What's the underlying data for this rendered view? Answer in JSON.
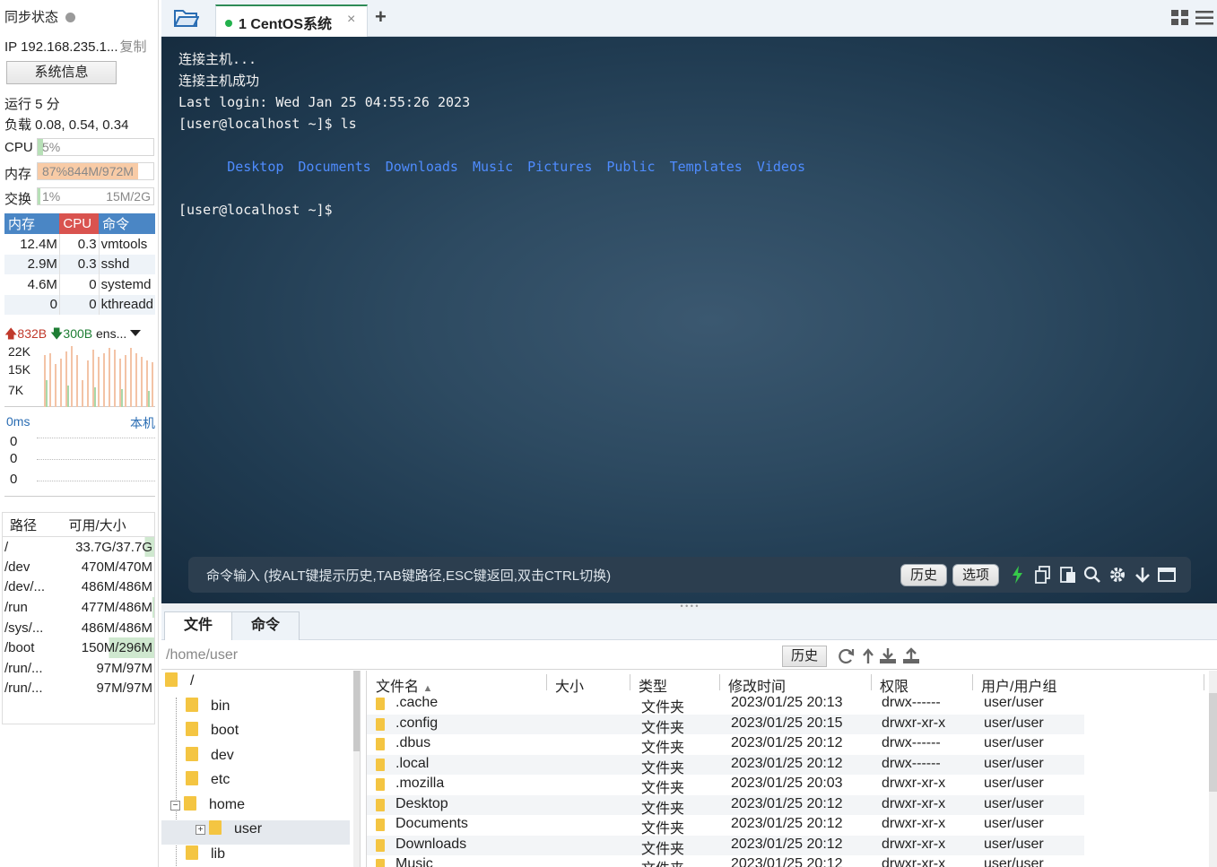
{
  "sidebar": {
    "sync_label": "同步状态",
    "ip_text": "IP 192.168.235.1...",
    "copy_label": "复制",
    "sysinfo_button": "系统信息",
    "uptime": "运行 5 分",
    "load": "负载 0.08, 0.54, 0.34",
    "cpu": {
      "label": "CPU",
      "text": "5%",
      "fraction": 0.05,
      "fill_color": "#b7e0b7"
    },
    "mem": {
      "label": "内存",
      "text": "87%844M/972M",
      "fraction": 0.87,
      "fill_color": "#f8cba6"
    },
    "swap": {
      "label": "交换",
      "text": "1%",
      "text_right": "15M/2G",
      "fraction": 0.01,
      "fill_color": "#b7e0b7"
    },
    "proc_headers": [
      {
        "label": "内存",
        "color": "#4a86c5"
      },
      {
        "label": "CPU",
        "color": "#d9534f"
      },
      {
        "label": "命令",
        "color": "#4a86c5"
      }
    ],
    "processes": [
      {
        "mem": "12.4M",
        "cpu": "0.3",
        "cmd": "vmtools"
      },
      {
        "mem": "2.9M",
        "cpu": "0.3",
        "cmd": "sshd"
      },
      {
        "mem": "4.6M",
        "cpu": "0",
        "cmd": "systemd"
      },
      {
        "mem": "0",
        "cpu": "0",
        "cmd": "kthreadd"
      }
    ],
    "net": {
      "up": "832B",
      "down": "300B",
      "iface": "ens...",
      "ticks": [
        "22K",
        "15K",
        "7K"
      ]
    },
    "ping": {
      "label": "0ms",
      "host": "本机",
      "values": [
        "0",
        "0",
        "0"
      ]
    },
    "disk_headers": [
      "路径",
      "可用/大小"
    ],
    "disks": [
      {
        "path": "/",
        "size": "33.7G/37.7G",
        "used_fraction": 0.1
      },
      {
        "path": "/dev",
        "size": "470M/470M",
        "used_fraction": 0
      },
      {
        "path": "/dev/...",
        "size": "486M/486M",
        "used_fraction": 0
      },
      {
        "path": "/run",
        "size": "477M/486M",
        "used_fraction": 0.02
      },
      {
        "path": "/sys/...",
        "size": "486M/486M",
        "used_fraction": 0
      },
      {
        "path": "/boot",
        "size": "150M/296M",
        "used_fraction": 0.49
      },
      {
        "path": "/run/...",
        "size": "97M/97M",
        "used_fraction": 0
      },
      {
        "path": "/run/...",
        "size": "97M/97M",
        "used_fraction": 0
      }
    ]
  },
  "tabbar": {
    "tab_label": "1 CentOS系统",
    "close_glyph": "×",
    "add_glyph": "+"
  },
  "terminal": {
    "lines": [
      "连接主机...",
      "连接主机成功",
      "Last login: Wed Jan 25 04:55:26 2023",
      "[user@localhost ~]$ ls"
    ],
    "ls_output": [
      "Desktop",
      "Documents",
      "Downloads",
      "Music",
      "Pictures",
      "Public",
      "Templates",
      "Videos"
    ],
    "prompt": "[user@localhost ~]$",
    "cmd_placeholder": "命令输入 (按ALT键提示历史,TAB键路径,ESC键返回,双击CTRL切换)",
    "history_btn": "历史",
    "options_btn": "选项"
  },
  "files": {
    "tab_files": "文件",
    "tab_commands": "命令",
    "path": "/home/user",
    "history_btn": "历史",
    "tree": [
      {
        "name": "/",
        "level": 0,
        "expander": ""
      },
      {
        "name": "bin",
        "level": 1,
        "expander": ""
      },
      {
        "name": "boot",
        "level": 1,
        "expander": ""
      },
      {
        "name": "dev",
        "level": 1,
        "expander": ""
      },
      {
        "name": "etc",
        "level": 1,
        "expander": ""
      },
      {
        "name": "home",
        "level": 1,
        "expander": "−"
      },
      {
        "name": "user",
        "level": 2,
        "expander": "+",
        "selected": true
      },
      {
        "name": "lib",
        "level": 1,
        "expander": ""
      }
    ],
    "columns": [
      "文件名",
      "大小",
      "类型",
      "修改时间",
      "权限",
      "用户/用户组"
    ],
    "sort_glyph": "▲",
    "rows": [
      {
        "name": ".cache",
        "size": "",
        "type": "文件夹",
        "mtime": "2023/01/25 20:13",
        "perm": "drwx------",
        "owner": "user/user"
      },
      {
        "name": ".config",
        "size": "",
        "type": "文件夹",
        "mtime": "2023/01/25 20:15",
        "perm": "drwxr-xr-x",
        "owner": "user/user"
      },
      {
        "name": ".dbus",
        "size": "",
        "type": "文件夹",
        "mtime": "2023/01/25 20:12",
        "perm": "drwx------",
        "owner": "user/user"
      },
      {
        "name": ".local",
        "size": "",
        "type": "文件夹",
        "mtime": "2023/01/25 20:12",
        "perm": "drwx------",
        "owner": "user/user"
      },
      {
        "name": ".mozilla",
        "size": "",
        "type": "文件夹",
        "mtime": "2023/01/25 20:03",
        "perm": "drwxr-xr-x",
        "owner": "user/user"
      },
      {
        "name": "Desktop",
        "size": "",
        "type": "文件夹",
        "mtime": "2023/01/25 20:12",
        "perm": "drwxr-xr-x",
        "owner": "user/user"
      },
      {
        "name": "Documents",
        "size": "",
        "type": "文件夹",
        "mtime": "2023/01/25 20:12",
        "perm": "drwxr-xr-x",
        "owner": "user/user"
      },
      {
        "name": "Downloads",
        "size": "",
        "type": "文件夹",
        "mtime": "2023/01/25 20:12",
        "perm": "drwxr-xr-x",
        "owner": "user/user"
      },
      {
        "name": "Music",
        "size": "",
        "type": "文件夹",
        "mtime": "2023/01/25 20:12",
        "perm": "drwxr-xr-x",
        "owner": "user/user"
      }
    ]
  },
  "colors": {
    "accent_green": "#22b14c",
    "ls_blue": "#4f8cff",
    "terminal_bg": "#2d4a61"
  }
}
